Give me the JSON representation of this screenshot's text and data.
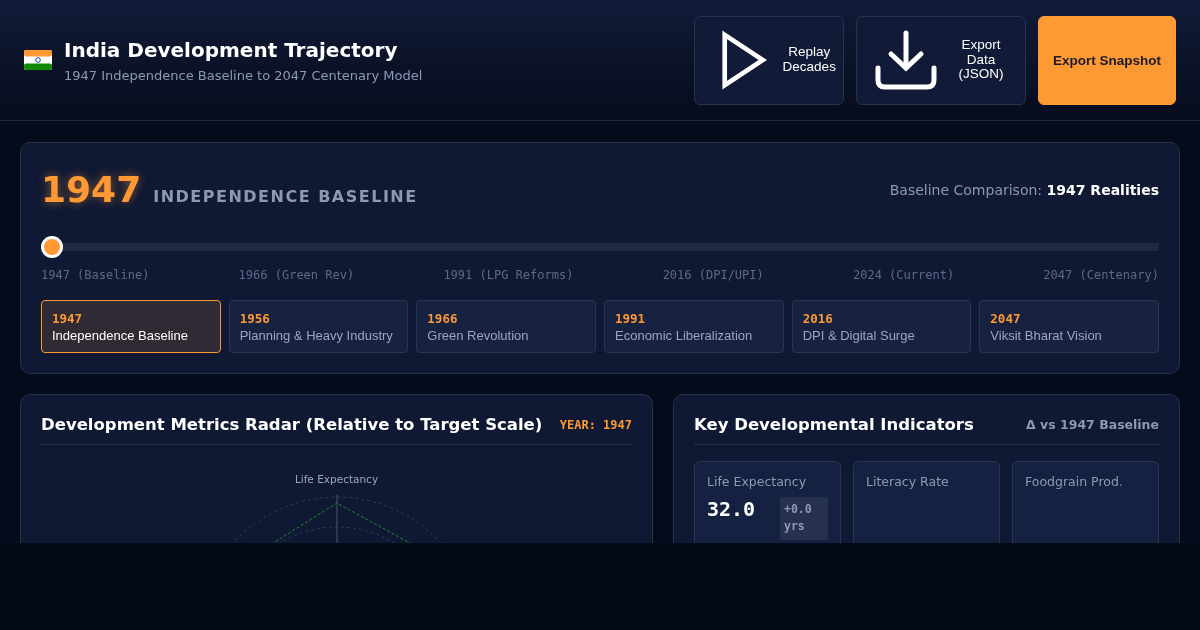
{
  "header": {
    "title": "India Development Trajectory",
    "subtitle": "1947 Independence Baseline to 2047 Centenary Model"
  },
  "actions": [
    {
      "kind": "play",
      "label": "Replay Decades"
    },
    {
      "kind": "download",
      "label": "Export Data (JSON)"
    },
    {
      "kind": "primary",
      "label": "Export Snapshot"
    }
  ],
  "timeline": {
    "year": "1947",
    "era": "INDEPENDENCE BASELINE",
    "comparison_label": "Baseline Comparison:",
    "comparison_value": "1947 Realities",
    "slider": {
      "level": 0
    },
    "ticks": [
      "1947 (Baseline)",
      "1966 (Green Rev)",
      "1991 (LPG Reforms)",
      "2016 (DPI/UPI)",
      "2024 (Current)",
      "2047 (Centenary)"
    ],
    "eras": [
      {
        "year": "1947",
        "label": "Independence Baseline",
        "selected": true
      },
      {
        "year": "1956",
        "label": "Planning & Heavy Industry",
        "selected": false
      },
      {
        "year": "1966",
        "label": "Green Revolution",
        "selected": false
      },
      {
        "year": "1991",
        "label": "Economic Liberalization",
        "selected": false
      },
      {
        "year": "2016",
        "label": "DPI & Digital Surge",
        "selected": false
      },
      {
        "year": "2047",
        "label": "Viksit Bharat Vision",
        "selected": false
      }
    ]
  },
  "radar": {
    "title": "Development Metrics Radar (Relative to Target Scale)",
    "year_badge": "YEAR: 1947",
    "axis_labels": [
      "Life Expectancy"
    ]
  },
  "indicators": {
    "title": "Key Developmental Indicators",
    "note": "Δ vs 1947 Baseline",
    "cards": [
      {
        "label": "Life Expectancy",
        "value": "32.0",
        "delta": "+0.0 yrs"
      },
      {
        "label": "Literacy Rate"
      },
      {
        "label": "Foodgrain Prod."
      }
    ]
  }
}
